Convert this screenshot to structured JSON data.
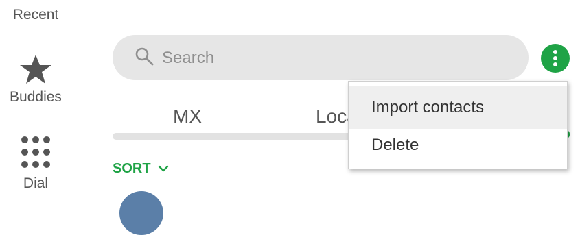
{
  "sidebar": {
    "items": [
      {
        "label": "Recent",
        "icon": "clock-icon"
      },
      {
        "label": "Buddies",
        "icon": "star-icon"
      },
      {
        "label": "Dial",
        "icon": "dialpad-icon"
      }
    ]
  },
  "search": {
    "placeholder": "Search",
    "value": ""
  },
  "more_button": {
    "icon": "vertical-dots-icon",
    "color": "#1fa346"
  },
  "tabs": [
    {
      "label": "MX"
    },
    {
      "label": "Local"
    }
  ],
  "sort": {
    "label": "SORT",
    "icon": "chevron-down-icon",
    "color": "#1fa346"
  },
  "menu": {
    "items": [
      {
        "label": "Import contacts"
      },
      {
        "label": "Delete"
      }
    ]
  },
  "colors": {
    "accent": "#1fa346",
    "search_bg": "#e6e6e6",
    "icon_gray": "#555555"
  }
}
